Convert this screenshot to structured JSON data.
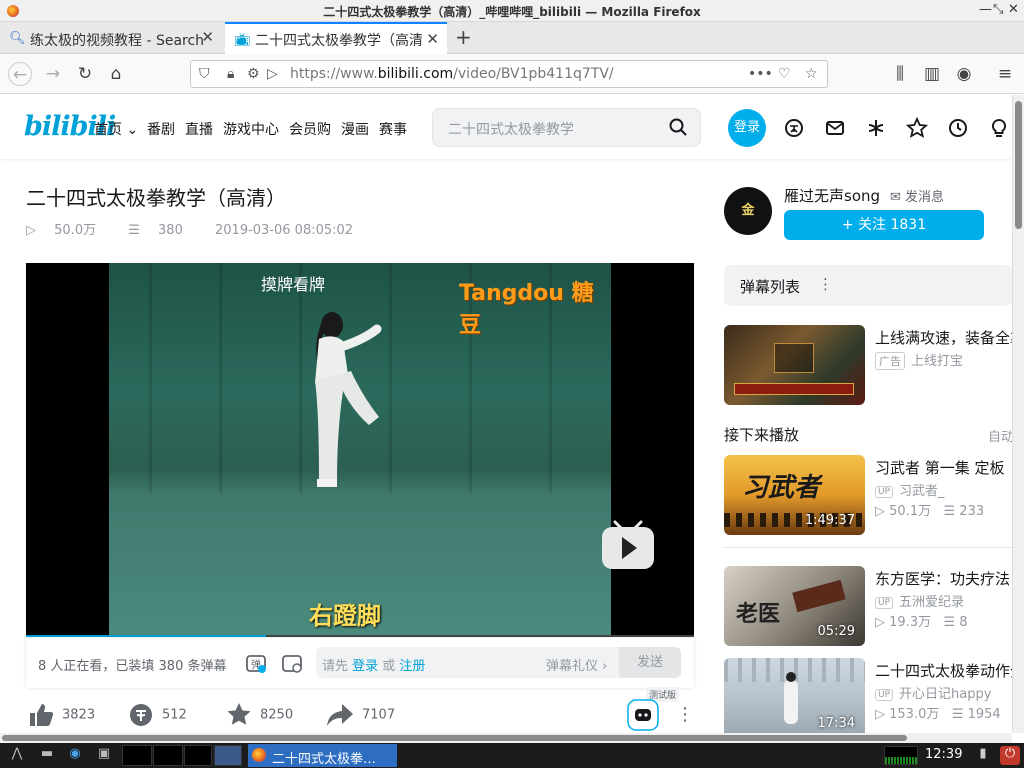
{
  "window": {
    "title": "二十四式太极拳教学（高清）_哔哩哔哩_bilibili — Mozilla Firefox"
  },
  "tabs": [
    {
      "label": "练太极的视频教程 - Search"
    },
    {
      "label": "二十四式太极拳教学（高清）"
    }
  ],
  "url": {
    "prefix": "https://www.",
    "domain": "bilibili.com",
    "path": "/video/BV1pb411q7TV/"
  },
  "site": {
    "logo": "bilibili",
    "nav": [
      "首页",
      "番剧",
      "直播",
      "游戏中心",
      "会员购",
      "漫画",
      "赛事"
    ],
    "search_placeholder": "二十四式太极拳教学",
    "login": "登录",
    "accent": "#00aeec"
  },
  "video": {
    "title": "二十四式太极拳教学（高清）",
    "views": "50.0万",
    "danmaku": "380",
    "date": "2019-03-06 08:05:02",
    "watermark_left": "摸牌看牌",
    "watermark_right": "Tangdou 糖豆",
    "subtitle": "右蹬脚",
    "progress": 0.36
  },
  "danmaku_bar": {
    "count_text": "8 人正在看，已装填 380 条弹幕",
    "hint_prefix": "请先 ",
    "login_link": "登录",
    "or": " 或 ",
    "register_link": "注册",
    "gift": "弹幕礼仪 ›",
    "send": "发送"
  },
  "actions": {
    "like": "3823",
    "coin": "512",
    "favorite": "8250",
    "share": "7107",
    "beta": "测试版"
  },
  "uploader": {
    "name": "雁过无声song",
    "message": "发消息",
    "follow": "+ 关注 1831",
    "avatar_text": "金"
  },
  "danmaku_list": {
    "label": "弹幕列表"
  },
  "ad": {
    "title": "上线满攻速，装备全靠",
    "badge": "广告",
    "sub": "上线打宝"
  },
  "next": {
    "label": "接下来播放",
    "autoplay": "自动"
  },
  "recommendations": [
    {
      "title": "习武者 第一集 定板",
      "up": "习武者_",
      "views": "50.1万",
      "danmaku": "233",
      "duration": "1:49:37"
    },
    {
      "title": "东方医学：功夫疗法",
      "up": "五洲爱纪录",
      "views": "19.3万",
      "danmaku": "8",
      "duration": "05:29"
    },
    {
      "title": "二十四式太极拳动作分",
      "up": "开心日记happy",
      "views": "153.0万",
      "danmaku": "1954",
      "duration": "17:34"
    }
  ],
  "taskbar": {
    "task": "二十四式太极拳…",
    "clock": "12:39"
  }
}
